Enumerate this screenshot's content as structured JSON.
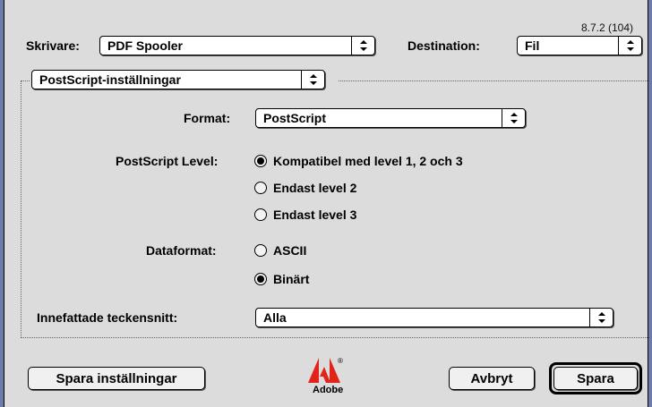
{
  "version": "8.7.2 (104)",
  "printer": {
    "label": "Skrivare:",
    "value": "PDF Spooler"
  },
  "destination": {
    "label": "Destination:",
    "value": "Fil"
  },
  "section_popup": {
    "value": "PostScript-inställningar"
  },
  "format": {
    "label": "Format:",
    "value": "PostScript"
  },
  "postscript_level": {
    "label": "PostScript Level:",
    "options": [
      {
        "label": "Kompatibel med level 1, 2 och 3",
        "selected": true
      },
      {
        "label": "Endast level 2",
        "selected": false
      },
      {
        "label": "Endast level 3",
        "selected": false
      }
    ]
  },
  "dataformat": {
    "label": "Dataformat:",
    "options": [
      {
        "label": "ASCII",
        "selected": false
      },
      {
        "label": "Binärt",
        "selected": true
      }
    ]
  },
  "embedded_fonts": {
    "label": "Innefattade teckensnitt:",
    "value": "Alla"
  },
  "buttons": {
    "save_settings": "Spara inställningar",
    "cancel": "Avbryt",
    "save": "Spara"
  },
  "logo": {
    "text": "Adobe",
    "icon": "adobe-logo-icon",
    "color": "#e2231a"
  },
  "colors": {
    "desktop": "#6e7aa8",
    "dialog": "#dcdcdc"
  }
}
